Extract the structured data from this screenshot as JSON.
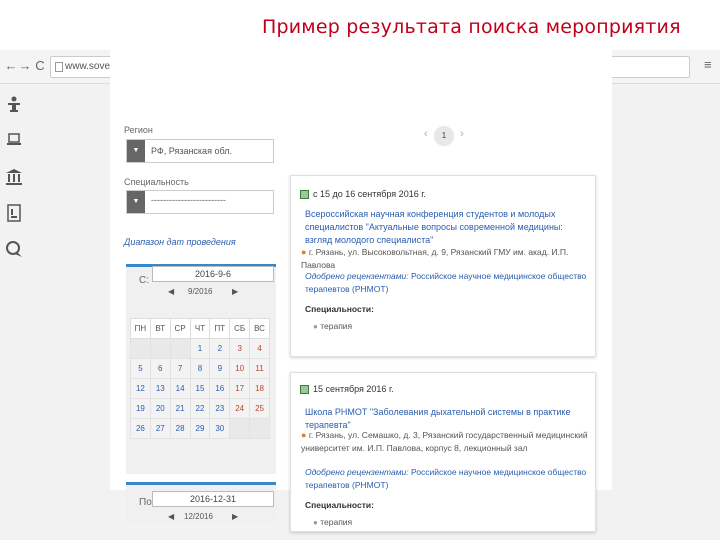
{
  "slide": {
    "title": "Пример результата поиска мероприятия"
  },
  "browser": {
    "url": "www.sovetnmo.ru/cgi-bin/unishell",
    "back_icon": "←",
    "forward_icon": "→",
    "reload_icon": "C",
    "menu_icon": "≡"
  },
  "filters": {
    "region_label": "Регион",
    "region_value": "РФ, Рязанская обл.",
    "specialty_label": "Специальность",
    "specialty_value": "-------------------------",
    "date_range_label": "Диапазон дат проведения",
    "select_arrow": "▼"
  },
  "calendar_from": {
    "from_label": "С:",
    "date_value": "2016-9-6",
    "month_label": "9/2016",
    "prev": "◀",
    "next": "▶",
    "weekdays": [
      "ПН",
      "ВТ",
      "СР",
      "ЧТ",
      "ПТ",
      "СБ",
      "ВС"
    ],
    "weeks": [
      [
        "",
        "",
        "",
        "1",
        "2",
        "3",
        "4"
      ],
      [
        "5",
        "6",
        "7",
        "8",
        "9",
        "10",
        "11"
      ],
      [
        "12",
        "13",
        "14",
        "15",
        "16",
        "17",
        "18"
      ],
      [
        "19",
        "20",
        "21",
        "22",
        "23",
        "24",
        "25"
      ],
      [
        "26",
        "27",
        "28",
        "29",
        "30",
        "",
        ""
      ]
    ]
  },
  "calendar_to": {
    "to_label": "По:",
    "date_value": "2016-12-31",
    "month_label": "12/2016",
    "prev": "◀",
    "next": "▶"
  },
  "pagination": {
    "prev": "‹",
    "page": "1",
    "next": "›"
  },
  "events": [
    {
      "date": "с 15 до 16 сентября 2016 г.",
      "title": "Всероссийская научная конференция студентов и молодых специалистов \"Актуальные вопросы современной медицины: взгляд молодого специалиста\"",
      "address": "г. Рязань, ул. Высоковольтная, д. 9, Рязанский ГМУ им. акад. И.П. Павлова",
      "approved_label": "Одобрено рецензентами:",
      "approved_value": "Российское научное медицинское общество терапевтов (РНМОТ)",
      "specialties_label": "Специальности:",
      "specialties": [
        "терапия"
      ]
    },
    {
      "date": "15 сентября 2016 г.",
      "title": "Школа РНМОТ \"Заболевания дыхательной системы в практике терапевта\"",
      "address": "г. Рязань, ул. Семашко, д. 3, Рязанский государственный медицинский университет им. И.П. Павлова, корпус 8, лекционный зал",
      "approved_label": "Одобрено рецензентами:",
      "approved_value": "Российское научное медицинское общество терапевтов (РНМОТ)",
      "specialties_label": "Специальности:",
      "specialties": [
        "терапия"
      ]
    }
  ],
  "icons": {
    "rail": [
      "person-icon",
      "laptop-icon",
      "bank-icon",
      "document-icon",
      "chat-icon"
    ]
  }
}
